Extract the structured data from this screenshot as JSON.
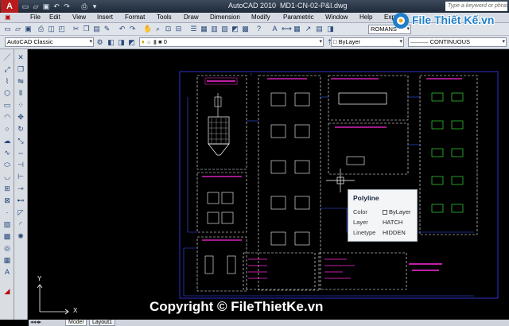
{
  "titlebar": {
    "app_name": "AutoCAD 2010",
    "file_name": "MD1-CN-02-P&I.dwg",
    "search_placeholder": "Type a keyword or phrase",
    "app_button": "A"
  },
  "menubar": {
    "items": [
      "File",
      "Edit",
      "View",
      "Insert",
      "Format",
      "Tools",
      "Draw",
      "Dimension",
      "Modify",
      "Parametric",
      "Window",
      "Help",
      "Express"
    ]
  },
  "toolbar": {
    "text_style": "ROMANS",
    "workspace": "AutoCAD Classic",
    "layer": "0",
    "color": "ByLayer",
    "linetype": "CONTINUOUS"
  },
  "tooltip": {
    "title": "Polyline",
    "rows": [
      {
        "key": "Color",
        "value": "ByLayer"
      },
      {
        "key": "Layer",
        "value": "HATCH"
      },
      {
        "key": "Linetype",
        "value": "HIDDEN"
      }
    ]
  },
  "tabs": {
    "model": "Model",
    "layout": "Layout1"
  },
  "ucs": {
    "x": "X",
    "y": "Y"
  },
  "watermark": {
    "logo_text": "File Thiết Kế.vn",
    "copyright": "Copyright © FileThietKe.vn"
  },
  "colors": {
    "frame": "#3b3bff",
    "label": "#ff2ad9",
    "symbol": "#ffffff",
    "hatch": "#40ff40",
    "wire": "#3355ff"
  },
  "icons": {
    "app": "autocad-logo-icon",
    "new": "new-file-icon",
    "open": "open-folder-icon",
    "save": "save-icon",
    "print": "print-icon",
    "undo": "undo-icon",
    "redo": "redo-icon",
    "pan": "pan-hand-icon",
    "zoom": "zoom-icon",
    "properties": "properties-icon",
    "layer": "layer-icon",
    "line": "line-icon",
    "circle": "circle-icon",
    "move": "move-icon",
    "copy": "copy-icon",
    "erase": "erase-icon"
  }
}
